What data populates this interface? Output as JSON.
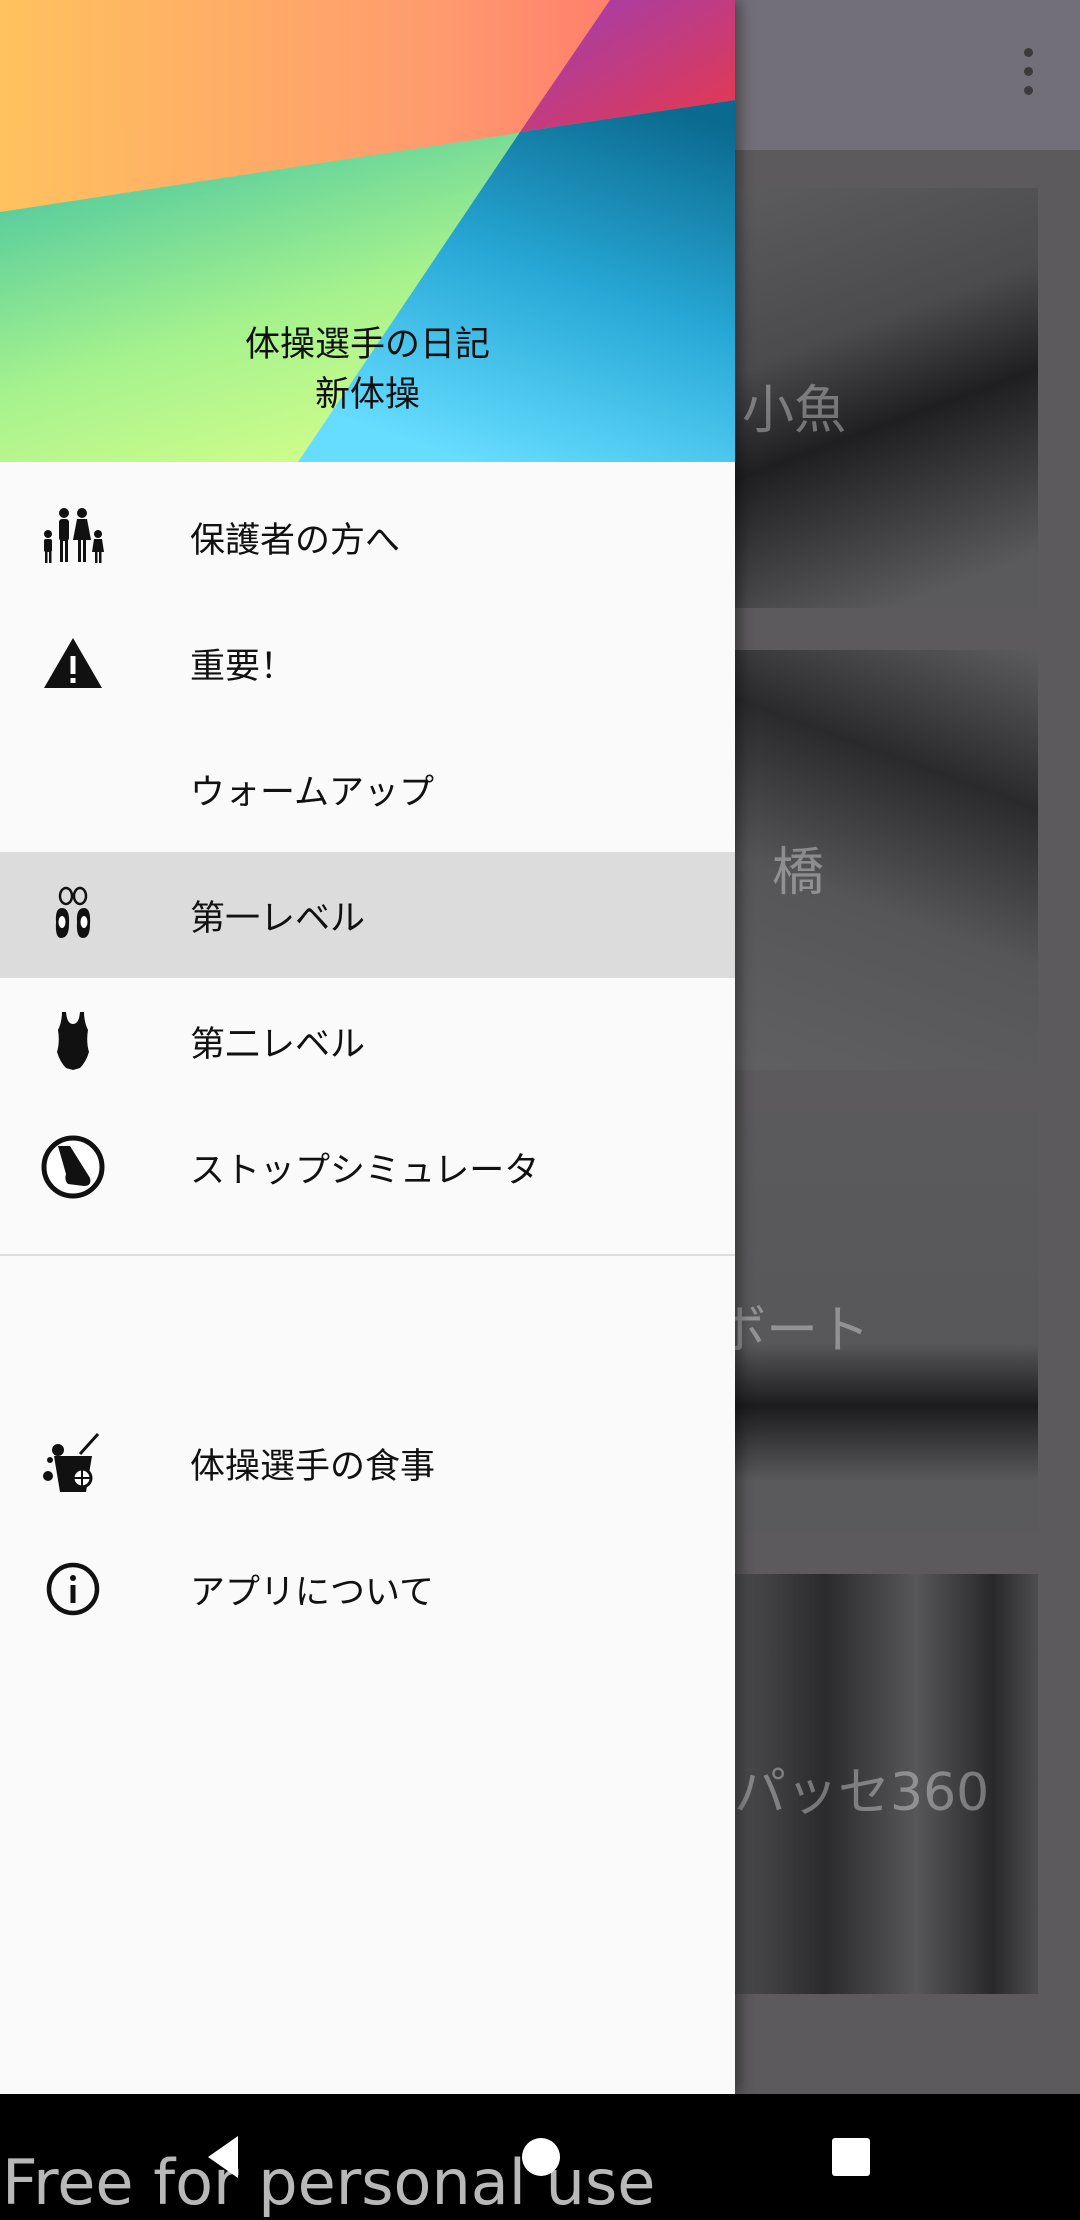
{
  "drawer": {
    "header": {
      "title_line1": "体操選手の日記",
      "title_line2": "新体操"
    },
    "items": [
      {
        "label": "保護者の方へ",
        "icon": "family-icon",
        "selected": false
      },
      {
        "label": "重要！",
        "icon": "warning-icon",
        "selected": false
      },
      {
        "label": "ウォームアップ",
        "icon": "",
        "selected": false
      },
      {
        "label": "第一レベル",
        "icon": "ballet-shoes-icon",
        "selected": true
      },
      {
        "label": "第二レベル",
        "icon": "leotard-icon",
        "selected": false
      },
      {
        "label": "ストップシミュレータ",
        "icon": "foot-stop-icon",
        "selected": false
      }
    ],
    "secondary_items": [
      {
        "label": "体操選手の食事",
        "icon": "drink-food-icon"
      },
      {
        "label": "アプリについて",
        "icon": "info-icon"
      }
    ]
  },
  "background_cards": [
    {
      "label": "小魚"
    },
    {
      "label": "橋"
    },
    {
      "label": "ボート"
    },
    {
      "label": "パッセ360"
    }
  ],
  "toolbar": {
    "menu_icon": "more-vert-icon"
  },
  "watermark": "Free for personal use",
  "colors": {
    "selected_item_bg": "#dcdcdc",
    "drawer_bg": "#fafafa",
    "scrim_toolbar": "#736f78"
  }
}
